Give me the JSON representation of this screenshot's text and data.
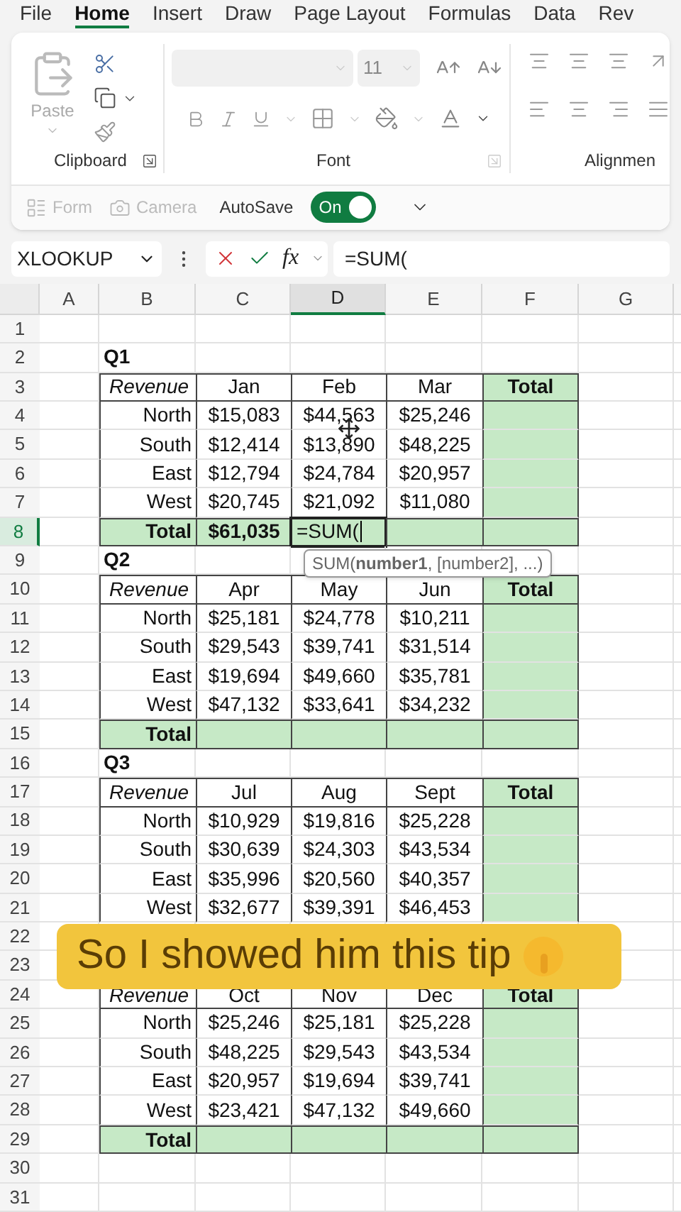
{
  "menu_tabs": [
    {
      "label": "File",
      "selected": false
    },
    {
      "label": "Home",
      "selected": true
    },
    {
      "label": "Insert",
      "selected": false
    },
    {
      "label": "Draw",
      "selected": false
    },
    {
      "label": "Page Layout",
      "selected": false
    },
    {
      "label": "Formulas",
      "selected": false
    },
    {
      "label": "Data",
      "selected": false
    },
    {
      "label": "Rev",
      "selected": false
    }
  ],
  "ribbon": {
    "clipboard": {
      "paste_label": "Paste",
      "group_label": "Clipboard"
    },
    "font": {
      "font_size": "11",
      "group_label": "Font"
    },
    "alignment": {
      "group_label": "Alignmen"
    }
  },
  "quick_bar": {
    "items": [
      {
        "label": "Form",
        "kind": "form",
        "disabled": true
      },
      {
        "label": "Camera",
        "kind": "camera",
        "disabled": true
      }
    ],
    "autosave": {
      "label": "AutoSave",
      "state_label": "On",
      "on": true
    }
  },
  "formula_bar": {
    "name_box": "XLOOKUP",
    "fx": "fx",
    "formula": "=SUM("
  },
  "sheet": {
    "columns": [
      {
        "label": "A",
        "selected": false
      },
      {
        "label": "B",
        "selected": false
      },
      {
        "label": "C",
        "selected": false
      },
      {
        "label": "D",
        "selected": true
      },
      {
        "label": "E",
        "selected": false
      },
      {
        "label": "F",
        "selected": false
      },
      {
        "label": "G",
        "selected": false
      }
    ],
    "rows": [
      {
        "number": "1",
        "selected": false,
        "kind": "blank"
      },
      {
        "number": "2",
        "selected": false,
        "kind": "title",
        "text": "Q1"
      },
      {
        "number": "3",
        "selected": false,
        "kind": "header",
        "cells": [
          "Revenue",
          "Jan",
          "Feb",
          "Mar",
          "Total"
        ]
      },
      {
        "number": "4",
        "selected": false,
        "kind": "data",
        "cells": [
          "North",
          "$15,083",
          "$44,563",
          "$25,246"
        ]
      },
      {
        "number": "5",
        "selected": false,
        "kind": "data",
        "cells": [
          "South",
          "$12,414",
          "$13,890",
          "$48,225"
        ]
      },
      {
        "number": "6",
        "selected": false,
        "kind": "data",
        "cells": [
          "East",
          "$12,794",
          "$24,784",
          "$20,957"
        ]
      },
      {
        "number": "7",
        "selected": false,
        "kind": "data",
        "cells": [
          "West",
          "$20,745",
          "$21,092",
          "$11,080"
        ]
      },
      {
        "number": "8",
        "selected": true,
        "kind": "total",
        "cells": [
          {
            "text": "Total",
            "editing": false
          },
          {
            "text": "$61,035",
            "editing": false
          },
          {
            "text": "=SUM(",
            "editing": true
          }
        ]
      },
      {
        "number": "9",
        "selected": false,
        "kind": "title",
        "text": "Q2"
      },
      {
        "number": "10",
        "selected": false,
        "kind": "header",
        "cells": [
          "Revenue",
          "Apr",
          "May",
          "Jun",
          "Total"
        ]
      },
      {
        "number": "11",
        "selected": false,
        "kind": "data",
        "cells": [
          "North",
          "$25,181",
          "$24,778",
          "$10,211"
        ]
      },
      {
        "number": "12",
        "selected": false,
        "kind": "data",
        "cells": [
          "South",
          "$29,543",
          "$39,741",
          "$31,514"
        ]
      },
      {
        "number": "13",
        "selected": false,
        "kind": "data",
        "cells": [
          "East",
          "$19,694",
          "$49,660",
          "$35,781"
        ]
      },
      {
        "number": "14",
        "selected": false,
        "kind": "data",
        "cells": [
          "West",
          "$47,132",
          "$33,641",
          "$34,232"
        ]
      },
      {
        "number": "15",
        "selected": false,
        "kind": "total",
        "cells": [
          {
            "text": "Total",
            "editing": false
          }
        ]
      },
      {
        "number": "16",
        "selected": false,
        "kind": "title",
        "text": "Q3"
      },
      {
        "number": "17",
        "selected": false,
        "kind": "header",
        "cells": [
          "Revenue",
          "Jul",
          "Aug",
          "Sept",
          "Total"
        ]
      },
      {
        "number": "18",
        "selected": false,
        "kind": "data",
        "cells": [
          "North",
          "$10,929",
          "$19,816",
          "$25,228"
        ]
      },
      {
        "number": "19",
        "selected": false,
        "kind": "data",
        "cells": [
          "South",
          "$30,639",
          "$24,303",
          "$43,534"
        ]
      },
      {
        "number": "20",
        "selected": false,
        "kind": "data",
        "cells": [
          "East",
          "$35,996",
          "$20,560",
          "$40,357"
        ]
      },
      {
        "number": "21",
        "selected": false,
        "kind": "data",
        "cells": [
          "West",
          "$32,677",
          "$39,391",
          "$46,453"
        ]
      },
      {
        "number": "22",
        "selected": false,
        "kind": "covered"
      },
      {
        "number": "23",
        "selected": false,
        "kind": "covered"
      },
      {
        "number": "24",
        "selected": false,
        "kind": "header",
        "cells": [
          "Revenue",
          "Oct",
          "Nov",
          "Dec",
          "Total"
        ]
      },
      {
        "number": "25",
        "selected": false,
        "kind": "data",
        "cells": [
          "North",
          "$25,246",
          "$25,181",
          "$25,228"
        ]
      },
      {
        "number": "26",
        "selected": false,
        "kind": "data",
        "cells": [
          "South",
          "$48,225",
          "$29,543",
          "$43,534"
        ]
      },
      {
        "number": "27",
        "selected": false,
        "kind": "data",
        "cells": [
          "East",
          "$20,957",
          "$19,694",
          "$39,741"
        ]
      },
      {
        "number": "28",
        "selected": false,
        "kind": "data",
        "cells": [
          "West",
          "$23,421",
          "$47,132",
          "$49,660"
        ]
      },
      {
        "number": "29",
        "selected": false,
        "kind": "total",
        "cells": [
          {
            "text": "Total",
            "editing": false
          }
        ]
      },
      {
        "number": "30",
        "selected": false,
        "kind": "blank"
      },
      {
        "number": "31",
        "selected": false,
        "kind": "blank"
      }
    ],
    "tooltip": "SUM(**number1**, [number2], ...)"
  },
  "caption": "So I showed him this tip"
}
